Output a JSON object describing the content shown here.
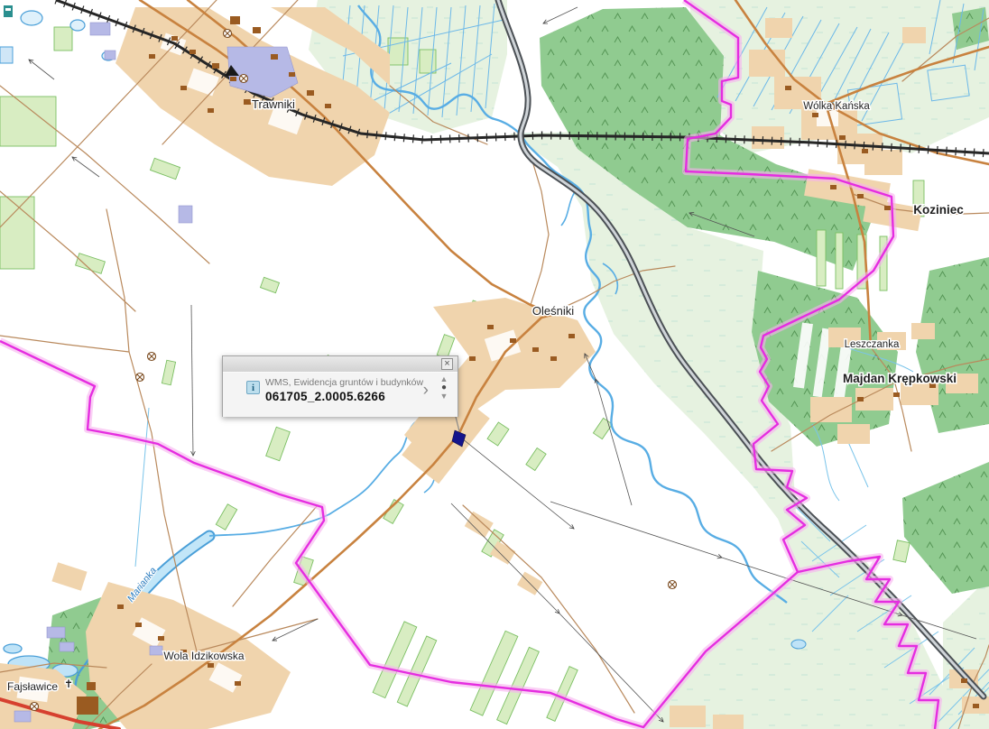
{
  "popup": {
    "source_label": "WMS, Ewidencja gruntów i budynków",
    "parcel_id": "061705_2.0005.6266",
    "close_glyph": "×",
    "chevron_glyph": "›",
    "pager_up": "▲",
    "pager_dot": "●",
    "pager_down": "▼"
  },
  "map": {
    "labels": {
      "trawniki": "Trawniki",
      "olesniki": "Oleśniki",
      "wolka_kanska": "Wólka Kańska",
      "koziniec": "Koziniec",
      "leszczanka": "Leszczanka",
      "majdan_krepkowski": "Majdan Krępkowski",
      "wola_idzikowska": "Wola Idzikowska",
      "fajslawice": "Fajsławice",
      "church_symbol": "✝",
      "river_name": "Marianka"
    },
    "colors": {
      "boundary": "#e52de0",
      "selected_parcel": "#14148c",
      "water": "#4a9fd8",
      "forest": "#90cb90",
      "builtup": "#f0d4ad"
    }
  }
}
